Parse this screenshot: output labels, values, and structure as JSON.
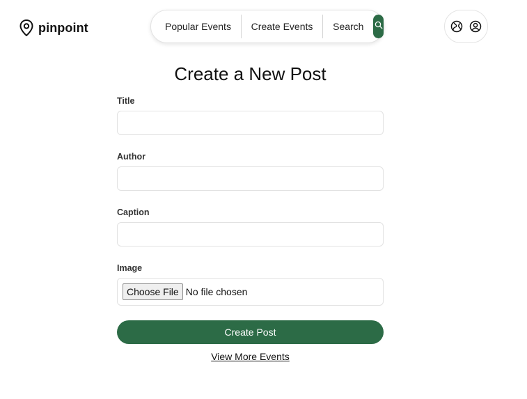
{
  "brand": {
    "name": "pinpoint",
    "icon": "map-pin-icon"
  },
  "nav": {
    "items": [
      {
        "label": "Popular Events"
      },
      {
        "label": "Create Events"
      },
      {
        "label": "Search"
      }
    ],
    "search_icon": "search-icon"
  },
  "header_icons": {
    "globe_icon": "globe-icon",
    "profile_icon": "user-icon"
  },
  "form": {
    "title": "Create a New Post",
    "fields": [
      {
        "label": "Title",
        "value": "",
        "placeholder": ""
      },
      {
        "label": "Author",
        "value": "",
        "placeholder": ""
      },
      {
        "label": "Caption",
        "value": "",
        "placeholder": ""
      }
    ],
    "image": {
      "label": "Image",
      "button_label": "Choose File",
      "status": "No file chosen"
    },
    "submit_label": "Create Post",
    "more_link": "View More Events"
  },
  "colors": {
    "accent": "#2c6b46",
    "border": "#e2e2e2"
  }
}
